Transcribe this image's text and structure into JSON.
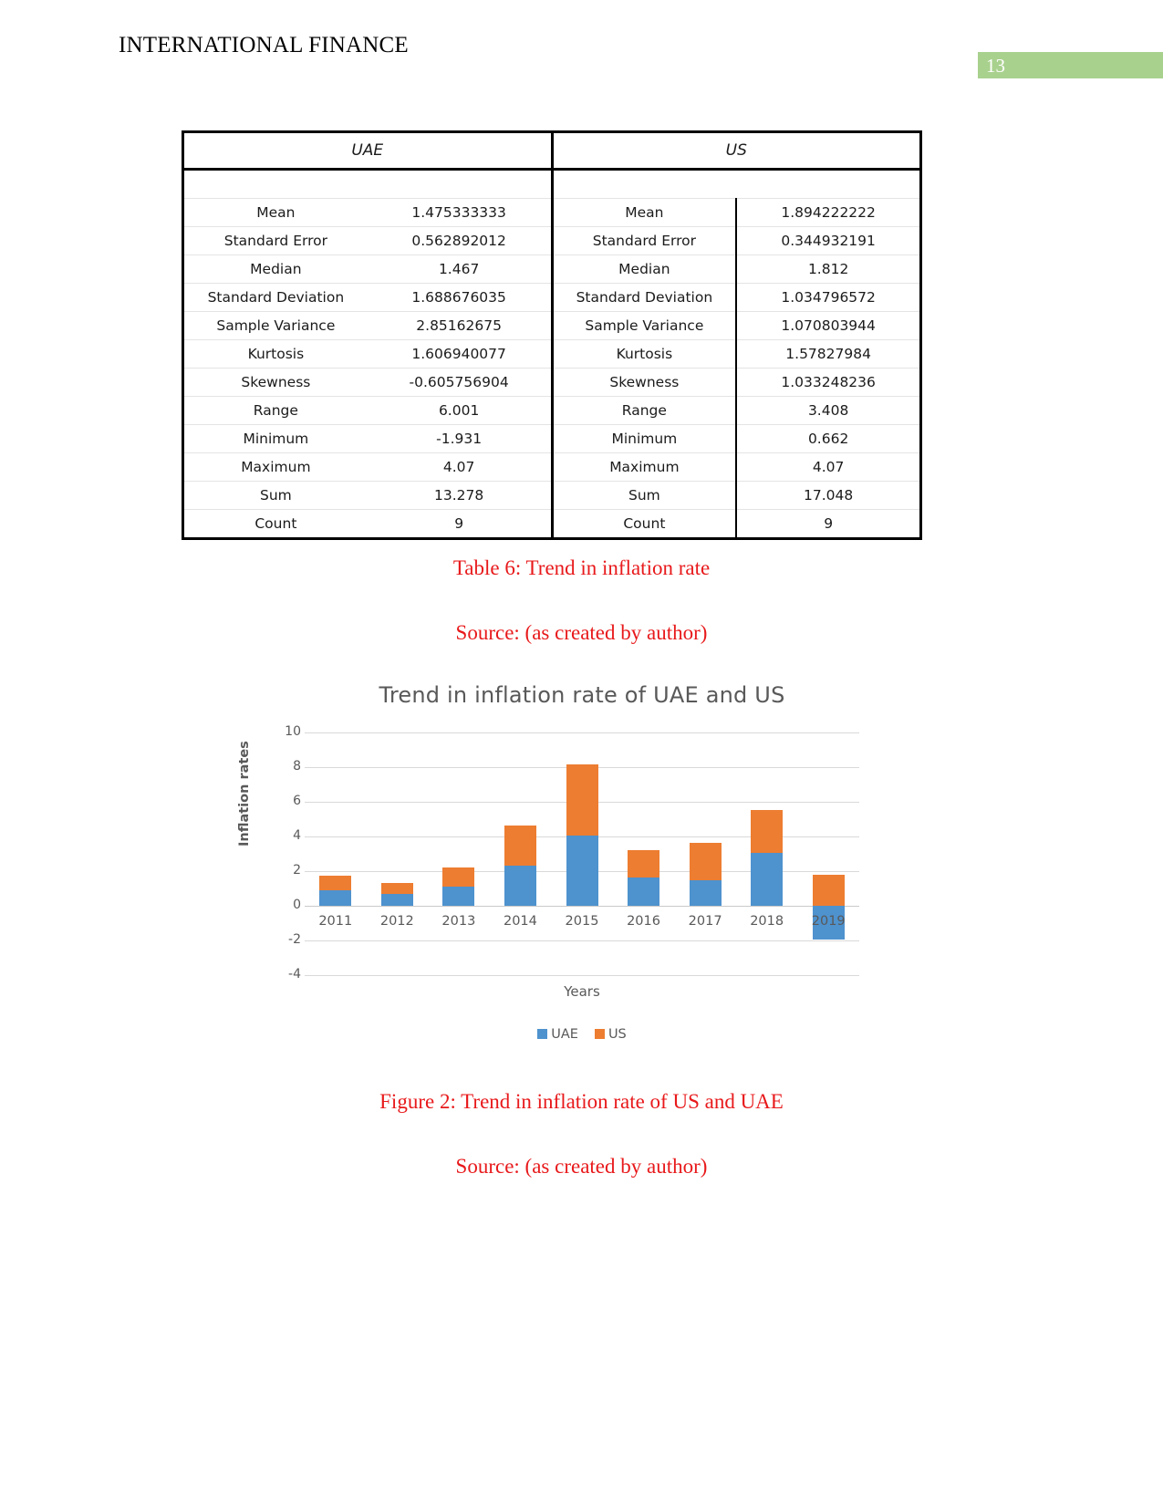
{
  "header": {
    "doc_title": "INTERNATIONAL FINANCE",
    "page_number": "13",
    "badge_color": "#a9d18e"
  },
  "stats_table": {
    "group_headers": [
      "UAE",
      "US"
    ],
    "rows": [
      {
        "uae_label": "Mean",
        "uae_value": "1.475333333",
        "us_label": "Mean",
        "us_value": "1.894222222"
      },
      {
        "uae_label": "Standard Error",
        "uae_value": "0.562892012",
        "us_label": "Standard Error",
        "us_value": "0.344932191"
      },
      {
        "uae_label": "Median",
        "uae_value": "1.467",
        "us_label": "Median",
        "us_value": "1.812"
      },
      {
        "uae_label": "Standard Deviation",
        "uae_value": "1.688676035",
        "us_label": "Standard Deviation",
        "us_value": "1.034796572"
      },
      {
        "uae_label": "Sample Variance",
        "uae_value": "2.85162675",
        "us_label": "Sample Variance",
        "us_value": "1.070803944"
      },
      {
        "uae_label": "Kurtosis",
        "uae_value": "1.606940077",
        "us_label": "Kurtosis",
        "us_value": "1.57827984"
      },
      {
        "uae_label": "Skewness",
        "uae_value": "-0.605756904",
        "us_label": "Skewness",
        "us_value": "1.033248236"
      },
      {
        "uae_label": "Range",
        "uae_value": "6.001",
        "us_label": "Range",
        "us_value": "3.408"
      },
      {
        "uae_label": "Minimum",
        "uae_value": "-1.931",
        "us_label": "Minimum",
        "us_value": "0.662"
      },
      {
        "uae_label": "Maximum",
        "uae_value": "4.07",
        "us_label": "Maximum",
        "us_value": "4.07"
      },
      {
        "uae_label": "Sum",
        "uae_value": "13.278",
        "us_label": "Sum",
        "us_value": "17.048"
      },
      {
        "uae_label": "Count",
        "uae_value": "9",
        "us_label": "Count",
        "us_value": "9"
      }
    ]
  },
  "captions": {
    "table_caption": "Table 6: Trend in inflation rate",
    "table_source": "Source: (as created by author)",
    "figure_caption": "Figure 2: Trend in inflation rate of US and UAE",
    "figure_source": "Source: (as created by author)",
    "color": "#e8191b"
  },
  "chart_data": {
    "type": "bar",
    "stacked": true,
    "title": "Trend in inflation rate of UAE and US",
    "xlabel": "Years",
    "ylabel": "Inflation rates",
    "categories": [
      "2011",
      "2012",
      "2013",
      "2014",
      "2015",
      "2016",
      "2017",
      "2018",
      "2019"
    ],
    "series": [
      {
        "name": "UAE",
        "color": "#4e92ce",
        "values": [
          0.88,
          0.66,
          1.1,
          2.34,
          4.07,
          1.62,
          1.46,
          3.06,
          -1.93
        ]
      },
      {
        "name": "US",
        "color": "#ed7d31",
        "values": [
          0.88,
          0.67,
          1.1,
          2.31,
          4.11,
          1.58,
          2.16,
          2.48,
          1.81
        ]
      }
    ],
    "ylim": [
      -4,
      10
    ],
    "yticks": [
      "10",
      "8",
      "6",
      "4",
      "2",
      "0",
      "-2",
      "-4"
    ],
    "grid": true,
    "legend_position": "bottom"
  }
}
